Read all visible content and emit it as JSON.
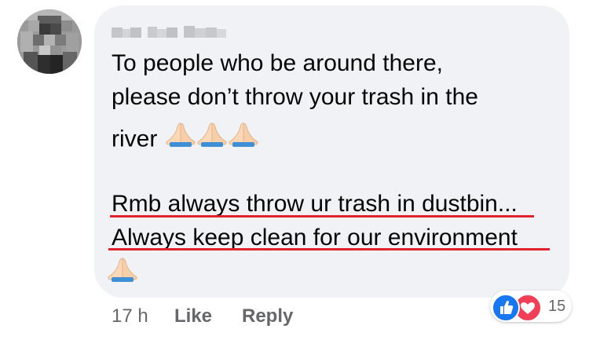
{
  "comment": {
    "author_name": "███ ███ ████",
    "lines": [
      "To people who be around there,",
      "please don’t throw your trash in the",
      "river",
      "Rmb always throw ur trash in dustbin...",
      "Always keep clean for our environment"
    ],
    "emoji_icon": "folded-hands-emoji",
    "underline_color": "#e0232e"
  },
  "footer": {
    "time": "17 h",
    "like_label": "Like",
    "reply_label": "Reply"
  },
  "reactions": {
    "icons": [
      "like-icon",
      "love-icon"
    ],
    "count": "15",
    "like_color": "#1877f2",
    "love_color": "#f33e58"
  }
}
